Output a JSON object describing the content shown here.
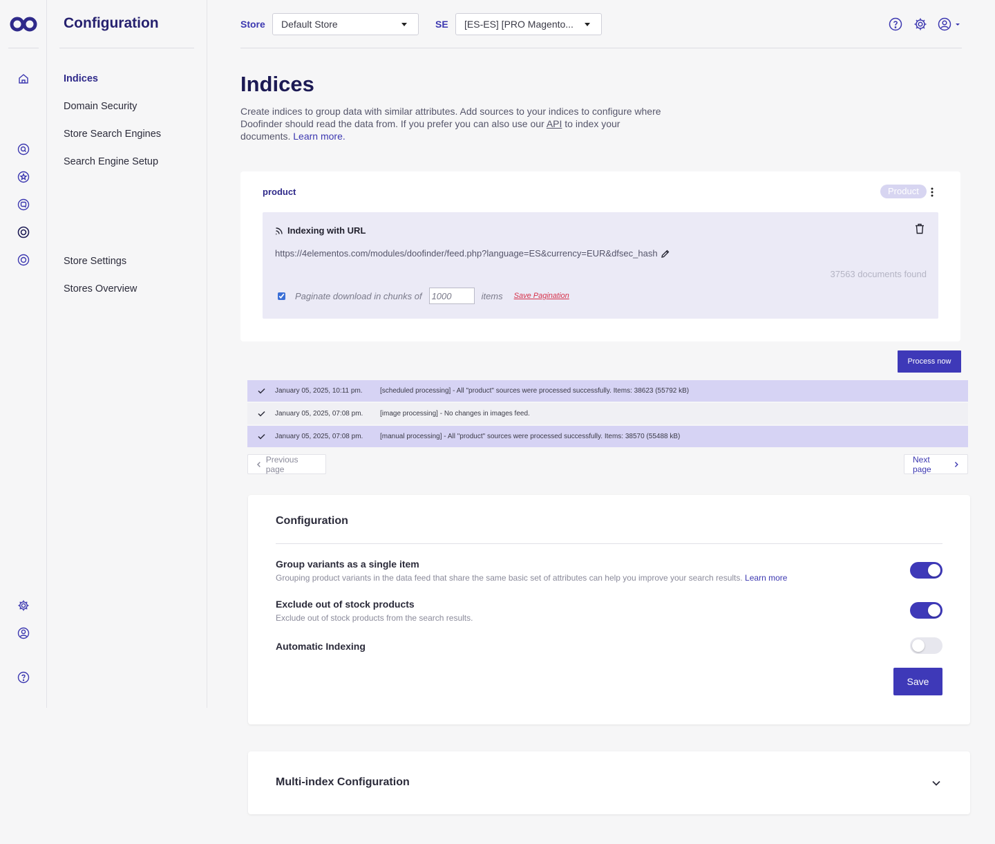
{
  "sidebar": {
    "title": "Configuration",
    "items": [
      {
        "label": "Indices",
        "active": true
      },
      {
        "label": "Domain Security"
      },
      {
        "label": "Store Search Engines"
      },
      {
        "label": "Search Engine Setup"
      },
      {
        "label": "Store Settings"
      },
      {
        "label": "Stores Overview"
      }
    ]
  },
  "rail_icons": [
    "home-icon",
    "search-icon",
    "star-icon",
    "chat-icon",
    "target-icon",
    "target-icon",
    "gear-icon",
    "user-icon",
    "help-icon"
  ],
  "topbar": {
    "store_label": "Store",
    "store_value": "Default Store",
    "se_label": "SE",
    "se_value": "[ES-ES] [PRO Magento..."
  },
  "page": {
    "title": "Indices",
    "description_1": "Create indices to group data with similar attributes. Add sources to your indices to configure where Doofinder should read the data from. If you prefer you can also use our ",
    "description_api": "API",
    "description_2": " to index your documents. ",
    "description_link": "Learn more."
  },
  "index": {
    "name": "product",
    "type_badge": "Product",
    "source": {
      "title": "Indexing with URL",
      "url": "https://4elementos.com/modules/doofinder/feed.php?language=ES&currency=EUR&dfsec_hash",
      "documents_found": "37563 documents found",
      "paginate_checked": true,
      "paginate_label": "Paginate download in chunks of",
      "paginate_value": "1000",
      "paginate_unit": "items",
      "save_pagination": "Save Pagination"
    }
  },
  "process_button": "Process now",
  "log": [
    {
      "date": "January 05, 2025, 10:11 pm.",
      "message": "[scheduled processing] - All \"product\" sources were processed successfully. Items: 38623 (55792 kB)"
    },
    {
      "date": "January 05, 2025, 07:08 pm.",
      "message": "[image processing] - No changes in images feed."
    },
    {
      "date": "January 05, 2025, 07:08 pm.",
      "message": "[manual processing] - All \"product\" sources were processed successfully. Items: 38570 (55488 kB)"
    }
  ],
  "pagination": {
    "prev": "Previous page",
    "next": "Next page"
  },
  "config": {
    "title": "Configuration",
    "options": [
      {
        "title": "Group variants as a single item",
        "description": "Grouping product variants in the data feed that share the same basic set of attributes can help you improve your search results. ",
        "link": "Learn more",
        "enabled": true
      },
      {
        "title": "Exclude out of stock products",
        "description": "Exclude out of stock products from the search results.",
        "enabled": true
      },
      {
        "title": "Automatic Indexing",
        "enabled": false
      }
    ],
    "save": "Save"
  },
  "multi_index": {
    "title": "Multi-index Configuration"
  },
  "colors": {
    "accent": "#3e39b8",
    "brand_dark": "#26216f",
    "log_highlight": "#d6d3f4",
    "error_link": "#d6314a"
  }
}
